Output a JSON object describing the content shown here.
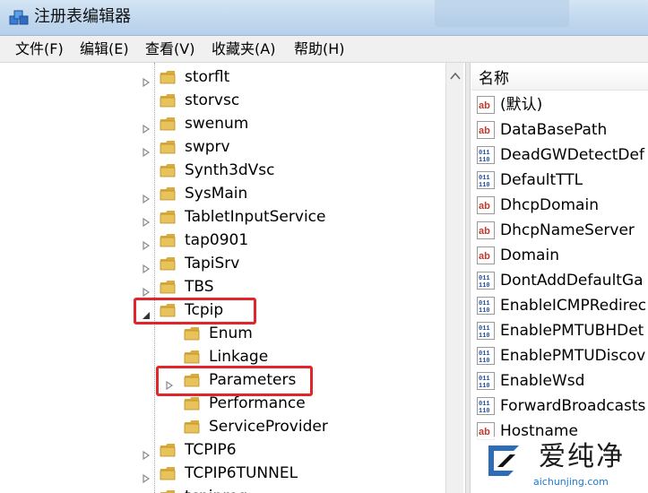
{
  "window": {
    "title": "注册表编辑器"
  },
  "menu": [
    "文件(F)",
    "编辑(E)",
    "查看(V)",
    "收藏夹(A)",
    "帮助(H)"
  ],
  "tree": {
    "items": [
      {
        "label": "storflt",
        "expander": "collapsed",
        "indent": 0
      },
      {
        "label": "storvsc",
        "expander": "none",
        "indent": 0
      },
      {
        "label": "swenum",
        "expander": "collapsed",
        "indent": 0
      },
      {
        "label": "swprv",
        "expander": "collapsed",
        "indent": 0
      },
      {
        "label": "Synth3dVsc",
        "expander": "none",
        "indent": 0
      },
      {
        "label": "SysMain",
        "expander": "collapsed",
        "indent": 0
      },
      {
        "label": "TabletInputService",
        "expander": "collapsed",
        "indent": 0
      },
      {
        "label": "tap0901",
        "expander": "collapsed",
        "indent": 0
      },
      {
        "label": "TapiSrv",
        "expander": "collapsed",
        "indent": 0
      },
      {
        "label": "TBS",
        "expander": "collapsed",
        "indent": 0
      },
      {
        "label": "Tcpip",
        "expander": "expanded",
        "indent": 0
      },
      {
        "label": "Enum",
        "expander": "none",
        "indent": 1
      },
      {
        "label": "Linkage",
        "expander": "none",
        "indent": 1
      },
      {
        "label": "Parameters",
        "expander": "collapsed",
        "indent": 1
      },
      {
        "label": "Performance",
        "expander": "none",
        "indent": 1
      },
      {
        "label": "ServiceProvider",
        "expander": "none",
        "indent": 1
      },
      {
        "label": "TCPIP6",
        "expander": "collapsed",
        "indent": 0
      },
      {
        "label": "TCPIP6TUNNEL",
        "expander": "collapsed",
        "indent": 0
      },
      {
        "label": "tcpipreg",
        "expander": "collapsed",
        "indent": 0
      }
    ],
    "highlighted": [
      "Tcpip",
      "Parameters"
    ]
  },
  "values": {
    "column_name": "名称",
    "items": [
      {
        "name": "(默认)",
        "type": "string"
      },
      {
        "name": "DataBasePath",
        "type": "string"
      },
      {
        "name": "DeadGWDetectDef",
        "type": "binary"
      },
      {
        "name": "DefaultTTL",
        "type": "binary"
      },
      {
        "name": "DhcpDomain",
        "type": "string"
      },
      {
        "name": "DhcpNameServer",
        "type": "string"
      },
      {
        "name": "Domain",
        "type": "string"
      },
      {
        "name": "DontAddDefaultGa",
        "type": "binary"
      },
      {
        "name": "EnableICMPRedirec",
        "type": "binary"
      },
      {
        "name": "EnablePMTUBHDet",
        "type": "binary"
      },
      {
        "name": "EnablePMTUDiscov",
        "type": "binary"
      },
      {
        "name": "EnableWsd",
        "type": "binary"
      },
      {
        "name": "ForwardBroadcasts",
        "type": "binary"
      },
      {
        "name": "Hostname",
        "type": "string"
      }
    ]
  },
  "watermark": {
    "text": "爱纯净",
    "url": "aichunjing.com"
  },
  "colors": {
    "highlight": "#e0262a",
    "folder": "#e8c25a",
    "titlebar": "#c1d8ee"
  }
}
